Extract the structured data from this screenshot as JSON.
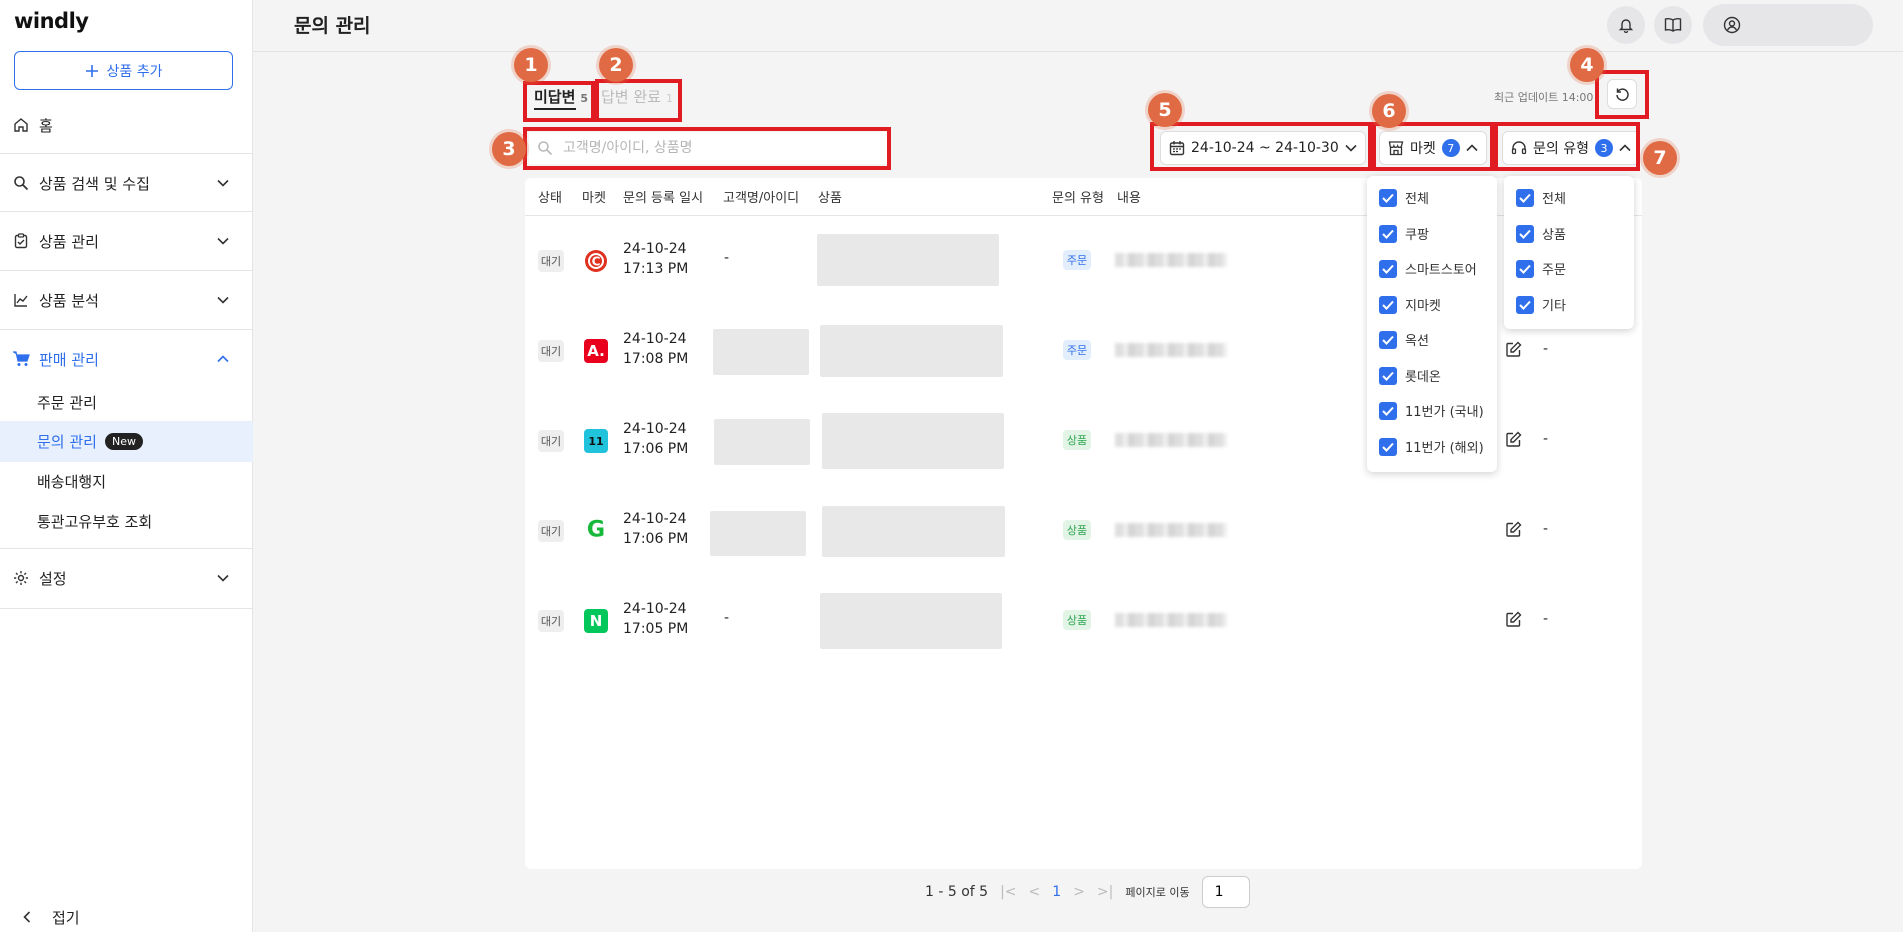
{
  "app": {
    "logo": "windly"
  },
  "sidebar": {
    "add_button": "상품 추가",
    "items": [
      {
        "label": "홈"
      },
      {
        "label": "상품 검색 및 수집"
      },
      {
        "label": "상품 관리"
      },
      {
        "label": "상품 분석"
      },
      {
        "label": "판매 관리"
      },
      {
        "label": "설정"
      }
    ],
    "sub_items": [
      {
        "label": "주문 관리"
      },
      {
        "label": "문의 관리",
        "badge": "New"
      },
      {
        "label": "배송대행지"
      },
      {
        "label": "통관고유부호 조회"
      }
    ],
    "collapse": "접기"
  },
  "header": {
    "title": "문의 관리"
  },
  "tabs": [
    {
      "label": "미답변",
      "count": "5"
    },
    {
      "label": "답변 완료",
      "count": "1"
    }
  ],
  "last_update": "최근 업데이트 14:00",
  "search": {
    "placeholder": "고객명/아이디, 상품명"
  },
  "filters": {
    "date_range": "24-10-24 ~ 24-10-30",
    "market": {
      "label": "마켓",
      "count": "7"
    },
    "inquiry_type": {
      "label": "문의 유형",
      "count": "3"
    }
  },
  "table": {
    "columns": [
      "상태",
      "마켓",
      "문의 등록 일시",
      "고객명/아이디",
      "상품",
      "문의 유형",
      "내용"
    ],
    "rows": [
      {
        "status": "대기",
        "market": "C",
        "date": "24-10-24",
        "time": "17:13 PM",
        "customer": "-",
        "type": "주문",
        "answer": ""
      },
      {
        "status": "대기",
        "market": "A.",
        "date": "24-10-24",
        "time": "17:08 PM",
        "customer": "",
        "type": "주문",
        "answer": "-"
      },
      {
        "status": "대기",
        "market": "11",
        "date": "24-10-24",
        "time": "17:06 PM",
        "customer": "",
        "type": "상품",
        "answer": "-"
      },
      {
        "status": "대기",
        "market": "G",
        "date": "24-10-24",
        "time": "17:06 PM",
        "customer": "",
        "type": "상품",
        "answer": "-"
      },
      {
        "status": "대기",
        "market": "N",
        "date": "24-10-24",
        "time": "17:05 PM",
        "customer": "-",
        "type": "상품",
        "answer": "-"
      }
    ]
  },
  "market_dropdown": [
    "전체",
    "쿠팡",
    "스마트스토어",
    "지마켓",
    "옥션",
    "롯데온",
    "11번가 (국내)",
    "11번가 (해외)"
  ],
  "type_dropdown": [
    "전체",
    "상품",
    "주문",
    "기타"
  ],
  "pagination": {
    "range": "1 - 5 of 5",
    "current": "1",
    "goto_label": "페이지로 이동",
    "goto_value": "1"
  },
  "annotations": [
    "1",
    "2",
    "3",
    "4",
    "5",
    "6",
    "7"
  ],
  "colors": {
    "accent": "#2f6fec",
    "highlight": "#e01c22",
    "marker": "#e06a43"
  }
}
